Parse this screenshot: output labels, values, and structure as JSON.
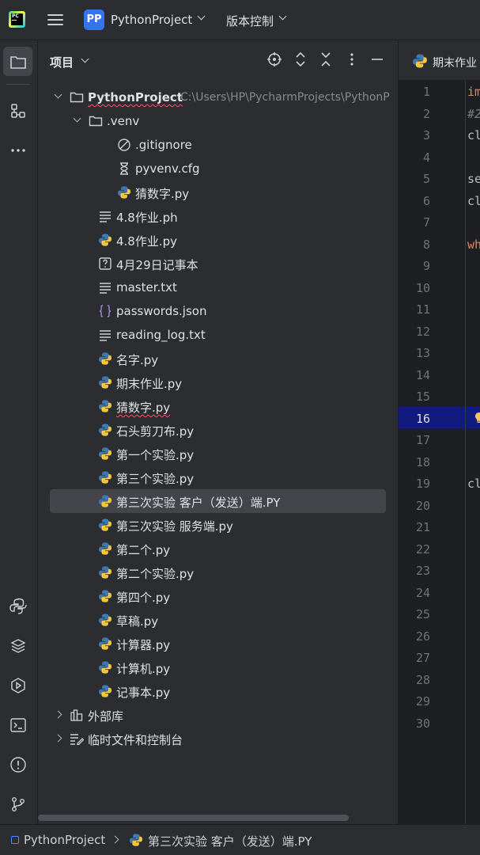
{
  "titlebar": {
    "project_badge": "PP",
    "project_name": "PythonProject",
    "vcs_label": "版本控制"
  },
  "panel": {
    "title": "项目"
  },
  "tree": [
    {
      "label": "PythonProject",
      "path": "C:\\Users\\HP\\PycharmProjects\\PythonP",
      "icon": "folder-icon",
      "depth": 0,
      "arrow": "down",
      "bold": true,
      "wavy": true
    },
    {
      "label": ".venv",
      "icon": "folder-icon",
      "depth": 1,
      "arrow": "down"
    },
    {
      "label": ".gitignore",
      "icon": "ignore-file-icon",
      "depth": 2
    },
    {
      "label": "pyvenv.cfg",
      "icon": "config-file-icon",
      "depth": 2
    },
    {
      "label": "猜数字.py",
      "icon": "python-file-icon",
      "depth": 2
    },
    {
      "label": "4.8作业.ph",
      "icon": "text-file-icon",
      "depth": 1
    },
    {
      "label": "4.8作业.py",
      "icon": "python-file-icon",
      "depth": 1
    },
    {
      "label": "4月29日记事本",
      "icon": "unknown-file-icon",
      "depth": 1
    },
    {
      "label": "master.txt",
      "icon": "text-file-icon",
      "depth": 1
    },
    {
      "label": "passwords.json",
      "icon": "json-file-icon",
      "depth": 1
    },
    {
      "label": "reading_log.txt",
      "icon": "text-file-icon",
      "depth": 1
    },
    {
      "label": "名字.py",
      "icon": "python-file-icon",
      "depth": 1
    },
    {
      "label": "期末作业.py",
      "icon": "python-file-icon",
      "depth": 1
    },
    {
      "label": "猜数字.py",
      "icon": "python-file-icon",
      "depth": 1,
      "wavy": true
    },
    {
      "label": "石头剪刀布.py",
      "icon": "python-file-icon",
      "depth": 1
    },
    {
      "label": "第一个实验.py",
      "icon": "python-file-icon",
      "depth": 1
    },
    {
      "label": "第三个实验.py",
      "icon": "python-file-icon",
      "depth": 1
    },
    {
      "label": "第三次实验 客户（发送）端.PY",
      "icon": "python-file-icon",
      "depth": 1,
      "selected": true
    },
    {
      "label": "第三次实验 服务端.py",
      "icon": "python-file-icon",
      "depth": 1
    },
    {
      "label": "第二个.py",
      "icon": "python-file-icon",
      "depth": 1
    },
    {
      "label": "第二个实验.py",
      "icon": "python-file-icon",
      "depth": 1
    },
    {
      "label": "第四个.py",
      "icon": "python-file-icon",
      "depth": 1
    },
    {
      "label": "草稿.py",
      "icon": "python-file-icon",
      "depth": 1
    },
    {
      "label": "计算器.py",
      "icon": "python-file-icon",
      "depth": 1
    },
    {
      "label": "计算机.py",
      "icon": "python-file-icon",
      "depth": 1
    },
    {
      "label": "记事本.py",
      "icon": "python-file-icon",
      "depth": 1
    },
    {
      "label": "外部库",
      "icon": "library-icon",
      "depth": 0,
      "arrow": "right"
    },
    {
      "label": "临时文件和控制台",
      "icon": "scratches-icon",
      "depth": 0,
      "arrow": "right"
    }
  ],
  "editor": {
    "tab_label": "期末作业",
    "line_numbers": [
      1,
      2,
      3,
      4,
      5,
      6,
      7,
      8,
      9,
      10,
      11,
      12,
      13,
      14,
      15,
      16,
      17,
      18,
      19,
      20,
      21,
      22,
      23,
      24,
      25,
      26,
      27,
      28,
      29,
      30
    ],
    "current_line": 16,
    "code_fragments": [
      {
        "line": 1,
        "text": "im",
        "kind": "kw"
      },
      {
        "line": 2,
        "text": "#2",
        "kind": "cm"
      },
      {
        "line": 3,
        "text": "cl",
        "kind": "plain"
      },
      {
        "line": 5,
        "text": "se",
        "kind": "plain"
      },
      {
        "line": 6,
        "text": "cl",
        "kind": "plain"
      },
      {
        "line": 8,
        "text": "wh",
        "kind": "kw"
      },
      {
        "line": 19,
        "text": "cl",
        "kind": "plain"
      }
    ]
  },
  "statusbar": {
    "project": "PythonProject",
    "file": "第三次实验 客户（发送）端.PY"
  }
}
